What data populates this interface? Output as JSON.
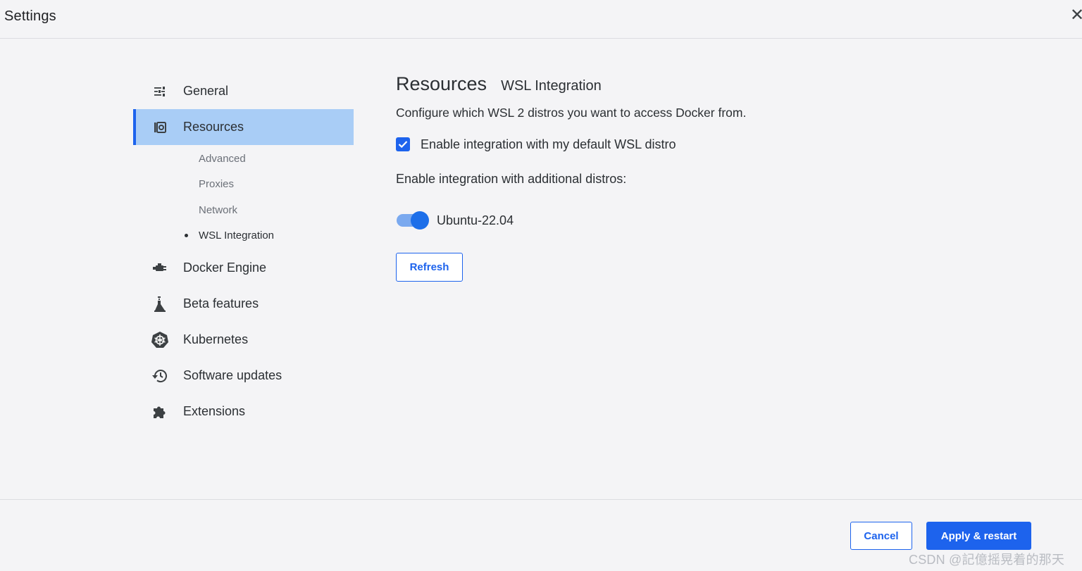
{
  "header": {
    "title": "Settings",
    "close_glyph": "✕"
  },
  "sidebar": {
    "items": [
      {
        "label": "General",
        "icon": "sliders-icon"
      },
      {
        "label": "Resources",
        "icon": "resources-icon",
        "active": true
      },
      {
        "label": "Docker Engine",
        "icon": "whale-engine-icon"
      },
      {
        "label": "Beta features",
        "icon": "flask-icon"
      },
      {
        "label": "Kubernetes",
        "icon": "kubernetes-helm-icon"
      },
      {
        "label": "Software updates",
        "icon": "history-icon"
      },
      {
        "label": "Extensions",
        "icon": "puzzle-icon"
      }
    ],
    "sub_items": [
      {
        "label": "Advanced"
      },
      {
        "label": "Proxies"
      },
      {
        "label": "Network"
      },
      {
        "label": "WSL Integration",
        "current": true
      }
    ]
  },
  "main": {
    "section_title": "Resources",
    "page_title": "WSL Integration",
    "description": "Configure which WSL 2 distros you want to access Docker from.",
    "default_distro_checkbox": {
      "label": "Enable integration with my default WSL distro",
      "checked": true
    },
    "additional_label": "Enable integration with additional distros:",
    "distros": [
      {
        "name": "Ubuntu-22.04",
        "enabled": true
      }
    ],
    "refresh_label": "Refresh"
  },
  "footer": {
    "cancel_label": "Cancel",
    "apply_label": "Apply & restart",
    "watermark": "CSDN @記億摇晃着的那天"
  },
  "colors": {
    "accent": "#1d63ed",
    "active_bg": "#a9cdf6",
    "background": "#f4f4f6",
    "toggle_track": "#7aa9ef"
  }
}
